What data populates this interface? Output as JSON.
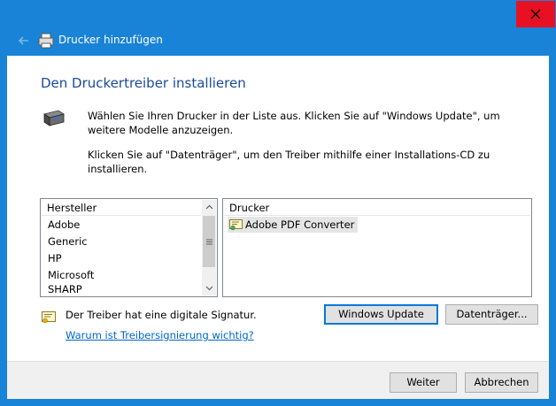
{
  "window": {
    "title": "Drucker hinzufügen"
  },
  "page": {
    "heading": "Den Druckertreiber installieren",
    "desc1": "Wählen Sie Ihren Drucker in der Liste aus. Klicken Sie auf \"Windows Update\", um weitere Modelle anzuzeigen.",
    "desc2": "Klicken Sie auf \"Datenträger\", um den Treiber mithilfe einer Installations-CD zu installieren."
  },
  "manufacturers": {
    "header": "Hersteller",
    "items": [
      "Adobe",
      "Generic",
      "HP",
      "Microsoft",
      "SHARP"
    ],
    "selected": "Adobe"
  },
  "printers": {
    "header": "Drucker",
    "items": [
      "Adobe PDF Converter"
    ]
  },
  "signature": {
    "text": "Der Treiber hat eine digitale Signatur.",
    "link": "Warum ist Treibersignierung wichtig?"
  },
  "buttons": {
    "windows_update": "Windows Update",
    "datentraeger": "Datenträger...",
    "weiter": "Weiter",
    "abbrechen": "Abbrechen"
  },
  "icons": {
    "close": "close-icon",
    "back": "back-arrow-icon",
    "printer": "printer-icon",
    "certificate": "certificate-icon"
  },
  "colors": {
    "titlebar": "#1883d7",
    "close": "#e81123",
    "heading": "#1a4a9a",
    "link": "#0066cc"
  }
}
